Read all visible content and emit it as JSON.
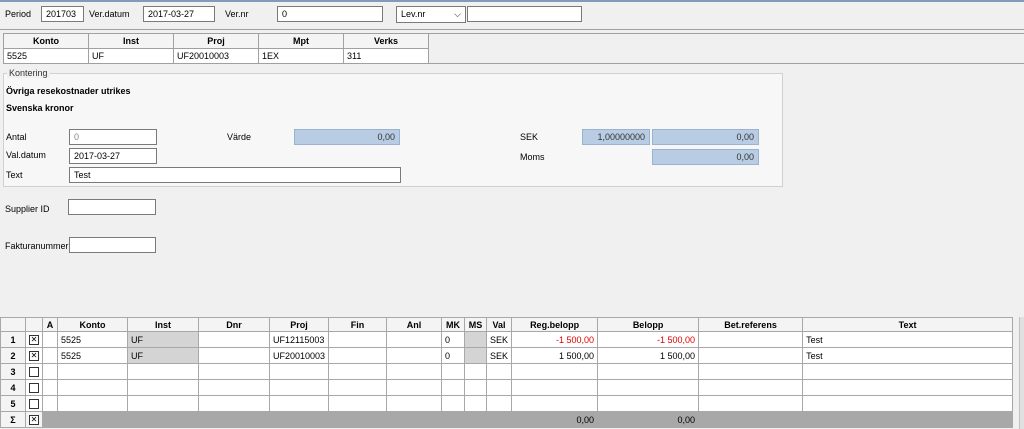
{
  "header": {
    "period_label": "Period",
    "period_value": "201703",
    "verdatum_label": "Ver.datum",
    "verdatum_value": "2017-03-27",
    "vernr_label": "Ver.nr",
    "vernr_value": "0",
    "levnr_selected": "Lev.nr",
    "levnr_value": ""
  },
  "dimgrid": {
    "columns": [
      "Konto",
      "Inst",
      "Proj",
      "Mpt",
      "Verks"
    ],
    "values": [
      "5525",
      "UF",
      "UF20010003",
      "1EX",
      "311"
    ]
  },
  "kontering": {
    "title": "Kontering",
    "account_desc": "Övriga resekostnader utrikes",
    "currency_desc": "Svenska kronor",
    "antal_label": "Antal",
    "antal_value": "0",
    "valdatum_label": "Val.datum",
    "valdatum_value": "2017-03-27",
    "text_label": "Text",
    "text_value": "Test",
    "varde_label": "Värde",
    "varde_value": "0,00",
    "sek_label": "SEK",
    "sek_rate": "1,00000000",
    "sek_value": "0,00",
    "moms_label": "Moms",
    "moms_value": "0,00"
  },
  "extra": {
    "supplier_label": "Supplier ID",
    "supplier_value": "",
    "faktura_label": "Fakturanummer",
    "faktura_value": ""
  },
  "rows": {
    "columns": [
      "A",
      "Konto",
      "Inst",
      "Dnr",
      "Proj",
      "Fin",
      "Anl",
      "MK",
      "MS",
      "Val",
      "Reg.belopp",
      "Belopp",
      "Bet.referens",
      "Text"
    ],
    "items": [
      {
        "n": "1",
        "konto": "5525",
        "inst": "UF",
        "dnr": "",
        "proj": "UF12115003",
        "fin": "",
        "anl": "",
        "mk": "0",
        "ms": "",
        "val": "SEK",
        "reg": "-1 500,00",
        "belopp": "-1 500,00",
        "bet": "",
        "text": "Test"
      },
      {
        "n": "2",
        "konto": "5525",
        "inst": "UF",
        "dnr": "",
        "proj": "UF20010003",
        "fin": "",
        "anl": "",
        "mk": "0",
        "ms": "",
        "val": "SEK",
        "reg": "1 500,00",
        "belopp": "1 500,00",
        "bet": "",
        "text": "Test"
      },
      {
        "n": "3"
      },
      {
        "n": "4"
      },
      {
        "n": "5"
      }
    ],
    "sum_symbol": "Σ",
    "sum_reg": "0,00",
    "sum_belopp": "0,00"
  }
}
